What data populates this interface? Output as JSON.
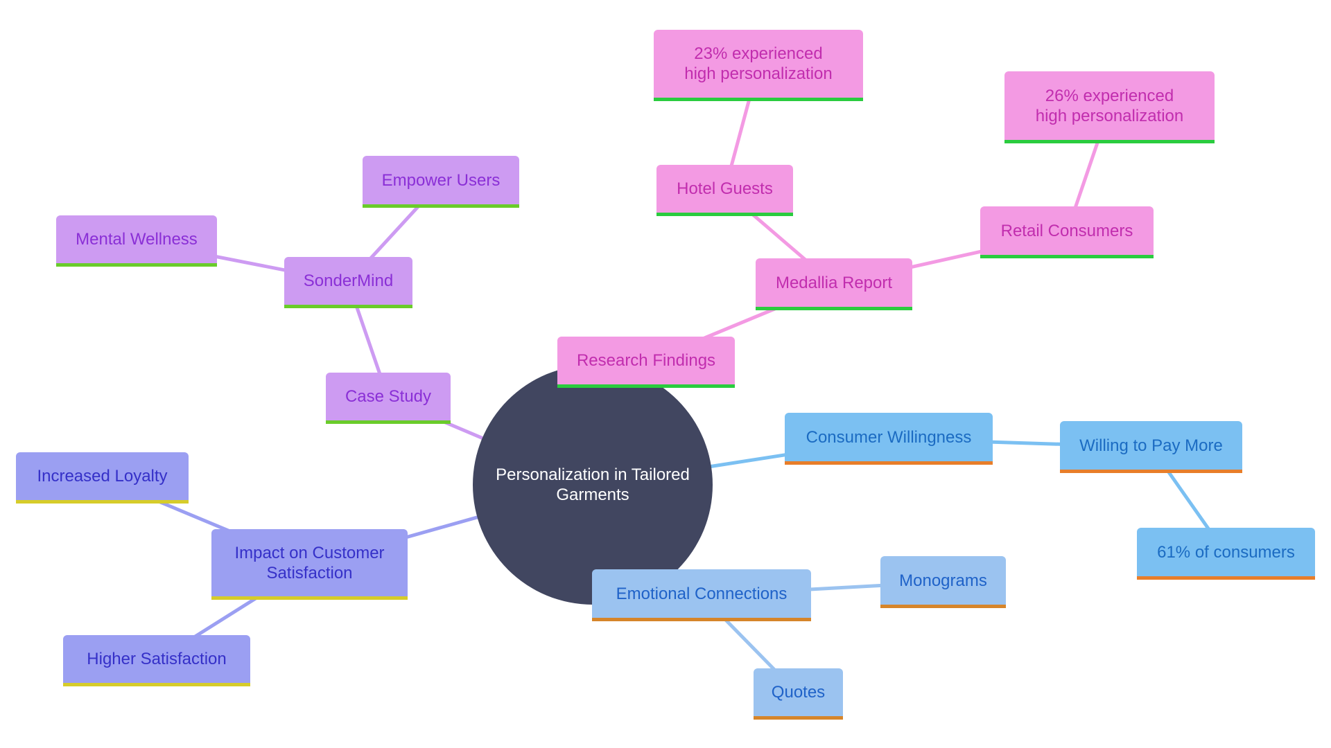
{
  "diagram": {
    "type": "mindmap",
    "root": {
      "id": "root",
      "label": "Personalization in Tailored Garments",
      "color": "#414660"
    },
    "themes": {
      "pink": {
        "fill": "#f39ae3",
        "text": "#c12dae",
        "underline": "#2acc3e",
        "edge": "#f39ae3"
      },
      "purple": {
        "fill": "#cd9bf2",
        "text": "#8a2fd6",
        "underline": "#6acc2a",
        "edge": "#cd9bf2"
      },
      "indigo": {
        "fill": "#9b9ff2",
        "text": "#3530c8",
        "underline": "#d6cc2a",
        "edge": "#9b9ff2"
      },
      "sky": {
        "fill": "#7bc0f2",
        "text": "#1b6bc2",
        "underline": "#e87e2a",
        "edge": "#7bc0f2"
      },
      "blue": {
        "fill": "#9bc3f0",
        "text": "#1f62c8",
        "underline": "#d6852a",
        "edge": "#9bc3f0"
      }
    },
    "nodes": {
      "research": {
        "label": "Research Findings",
        "theme": "pink",
        "parent": "root"
      },
      "medallia": {
        "label": "Medallia Report",
        "theme": "pink",
        "parent": "research"
      },
      "hotel": {
        "label": "Hotel Guests",
        "theme": "pink",
        "parent": "medallia"
      },
      "hotel_stat": {
        "label": "23% experienced high personalization",
        "theme": "pink",
        "parent": "hotel"
      },
      "retail": {
        "label": "Retail Consumers",
        "theme": "pink",
        "parent": "medallia"
      },
      "retail_stat": {
        "label": "26% experienced high personalization",
        "theme": "pink",
        "parent": "retail"
      },
      "case": {
        "label": "Case Study",
        "theme": "purple",
        "parent": "root"
      },
      "sondermind": {
        "label": "SonderMind",
        "theme": "purple",
        "parent": "case"
      },
      "mental": {
        "label": "Mental Wellness",
        "theme": "purple",
        "parent": "sondermind"
      },
      "empower": {
        "label": "Empower Users",
        "theme": "purple",
        "parent": "sondermind"
      },
      "impact": {
        "label": "Impact on Customer Satisfaction",
        "theme": "indigo",
        "parent": "root"
      },
      "loyalty": {
        "label": "Increased Loyalty",
        "theme": "indigo",
        "parent": "impact"
      },
      "higher": {
        "label": "Higher Satisfaction",
        "theme": "indigo",
        "parent": "impact"
      },
      "willingness": {
        "label": "Consumer Willingness",
        "theme": "sky",
        "parent": "root"
      },
      "paymore": {
        "label": "Willing to Pay More",
        "theme": "sky",
        "parent": "willingness"
      },
      "pct61": {
        "label": "61% of consumers",
        "theme": "sky",
        "parent": "paymore"
      },
      "emotional": {
        "label": "Emotional Connections",
        "theme": "blue",
        "parent": "root"
      },
      "monograms": {
        "label": "Monograms",
        "theme": "blue",
        "parent": "emotional"
      },
      "quotes": {
        "label": "Quotes",
        "theme": "blue",
        "parent": "emotional"
      }
    }
  }
}
